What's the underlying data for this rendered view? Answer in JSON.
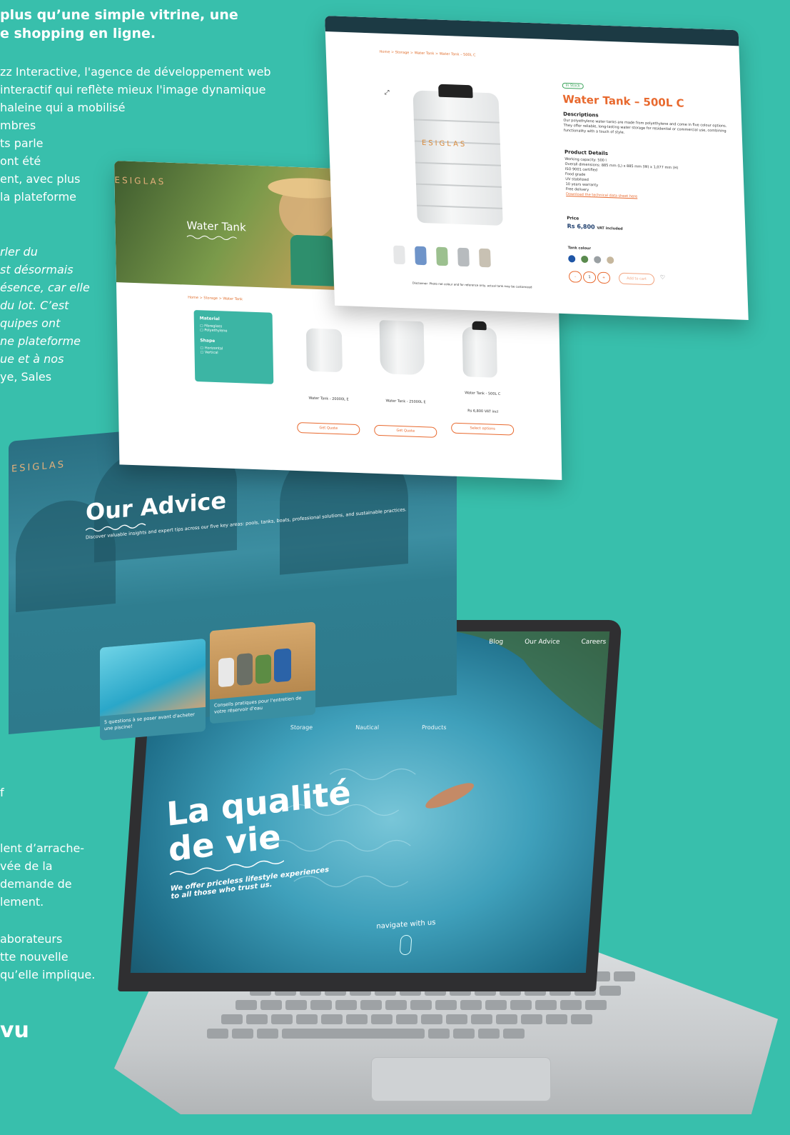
{
  "article": {
    "headline_lines": [
      "plus qu’une simple vitrine, une",
      "e shopping en ligne."
    ],
    "para1": [
      "zz Interactive, l'agence de développement web",
      "interactif qui reflète mieux l'image dynamique",
      "haleine qui a mobilisé",
      "mbres",
      "ts parle",
      "ont été",
      "ent, avec plus",
      "la plateforme"
    ],
    "quote": [
      "rler du",
      "st désormais",
      "ésence, car elle",
      "du lot. C’est",
      "quipes ont",
      "ne plateforme",
      "ue et à nos",
      "ye, Sales"
    ],
    "para2": [
      "f"
    ],
    "para3": [
      "lent d’arrache-",
      "vée de la",
      "demande de",
      "lement."
    ],
    "para4": [
      "aborateurs",
      "tte nouvelle",
      "qu’elle implique."
    ],
    "closing": "vu"
  },
  "product_page": {
    "breadcrumb": "Home > Storage > Water Tank > Water Tank – 500L C",
    "brand_on_tank": "ESIGLAS",
    "stock_badge": "In Stock",
    "title": "Water Tank – 500L C",
    "descriptions_heading": "Descriptions",
    "description_text": "Our polyethylene water tanks are made from polyethylene and come in five colour options. They offer reliable, long-lasting water storage for residential or commercial use, combining functionality with a touch of style.",
    "details_heading": "Product Details",
    "details": [
      "Working capacity: 500 l",
      "Overall dimensions: 885 mm (L) x 885 mm (W) x 1,077 mm (H)",
      "ISO 9001 certified",
      "Food grade",
      "UV stabilized",
      "10 years warranty",
      "Free delivery"
    ],
    "datasheet_link": "Download the technical data sheet here",
    "price_heading": "Price",
    "price": "Rs 6,800",
    "price_note": "VAT included",
    "colour_heading": "Tank colour",
    "colours": [
      "#1f56a6",
      "#5a8a4e",
      "#9aa0a3",
      "#c6b79d"
    ],
    "thumb_colours": [
      "#e6e7e8",
      "#6f94c9",
      "#9cc08f",
      "#b7bbbe",
      "#c8c1b3"
    ],
    "qty_minus": "–",
    "qty_value": "1",
    "qty_plus": "+",
    "add_to_cart": "Add to cart",
    "disclaimer": "Disclaimer: Photo not colour and for reference only, actual tank may be customized"
  },
  "category_page": {
    "hero_title": "Water Tank",
    "hero_logo": "ESIGLAS",
    "breadcrumb": "Home > Storage > Water Tank",
    "filter_material": "Material",
    "filter_material_options": [
      "Fibreglass",
      "Polyethylene"
    ],
    "filter_shape": "Shape",
    "filter_shape_options": [
      "Horizontal",
      "Vertical"
    ],
    "products": [
      {
        "name": "Water Tank - 20000L E",
        "price": "",
        "button": "Get Quote"
      },
      {
        "name": "Water Tank - 25000L E",
        "price": "",
        "button": "Get Quote"
      },
      {
        "name": "Water Tank - 500L C",
        "price": "Rs 6,800 VAT incl",
        "button": "Select options"
      }
    ]
  },
  "advice_page": {
    "logo": "ESIGLAS",
    "title": "Our Advice",
    "subtitle": "Discover valuable insights and expert tips across our five key areas: pools, tanks, boats, professional solutions, and sustainable practices.",
    "cards": [
      "5 questions à se poser avant d'acheter une piscine!",
      "Conseils pratiques pour l'entretien de votre réservoir d'eau"
    ]
  },
  "laptop_screen": {
    "nav": [
      "Blog",
      "Our Advice",
      "Careers"
    ],
    "subnav": [
      "Storage",
      "Nautical",
      "Products"
    ],
    "hero_title_line1": "La qualité",
    "hero_title_line2": "de vie",
    "hero_sub_line1": "We offer priceless lifestyle experiences",
    "hero_sub_line2": "to all those who trust us.",
    "navigate": "navigate with us"
  }
}
